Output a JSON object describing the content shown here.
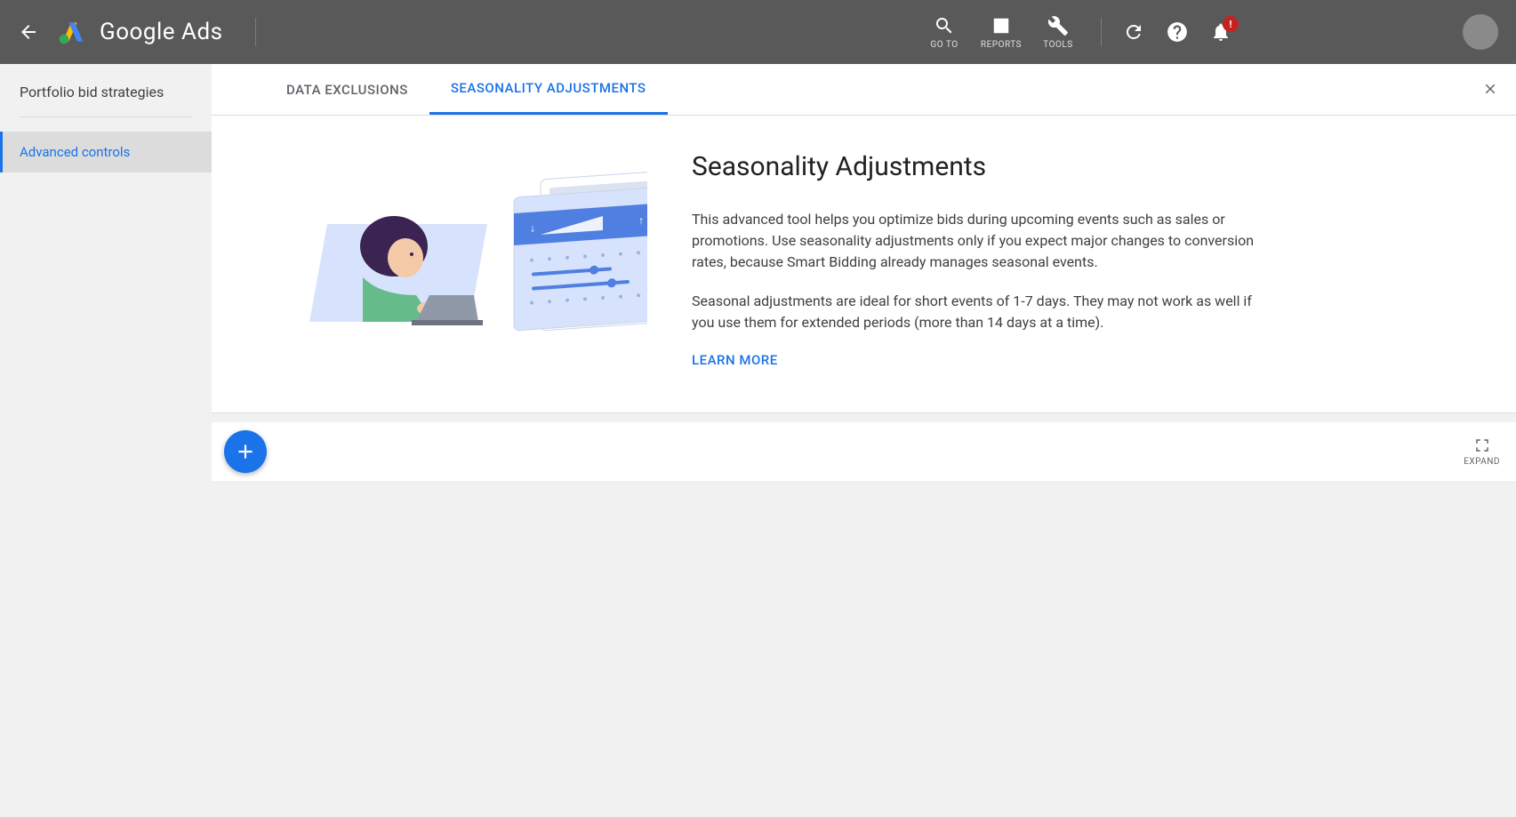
{
  "header": {
    "product": "Google Ads",
    "tools": [
      {
        "label": "GO TO",
        "icon": "search"
      },
      {
        "label": "REPORTS",
        "icon": "bar-chart"
      },
      {
        "label": "TOOLS",
        "icon": "wrench"
      }
    ],
    "notification_badge": "!"
  },
  "sidebar": {
    "title": "Portfolio bid strategies",
    "items": [
      {
        "label": "Advanced controls",
        "active": true
      }
    ]
  },
  "tabs": [
    {
      "label": "DATA EXCLUSIONS",
      "active": false
    },
    {
      "label": "SEASONALITY ADJUSTMENTS",
      "active": true
    }
  ],
  "hero": {
    "title": "Seasonality Adjustments",
    "para1": "This advanced tool helps you optimize bids during upcoming events such as sales or promotions. Use seasonality adjustments only if you expect major changes to conversion rates, because Smart Bidding already manages seasonal events.",
    "para2": "Seasonal adjustments are ideal for short events of 1-7 days. They may not work as well if you use them for extended periods (more than 14 days at a time).",
    "learn_more": "LEARN MORE"
  },
  "action_bar": {
    "expand_label": "EXPAND"
  }
}
